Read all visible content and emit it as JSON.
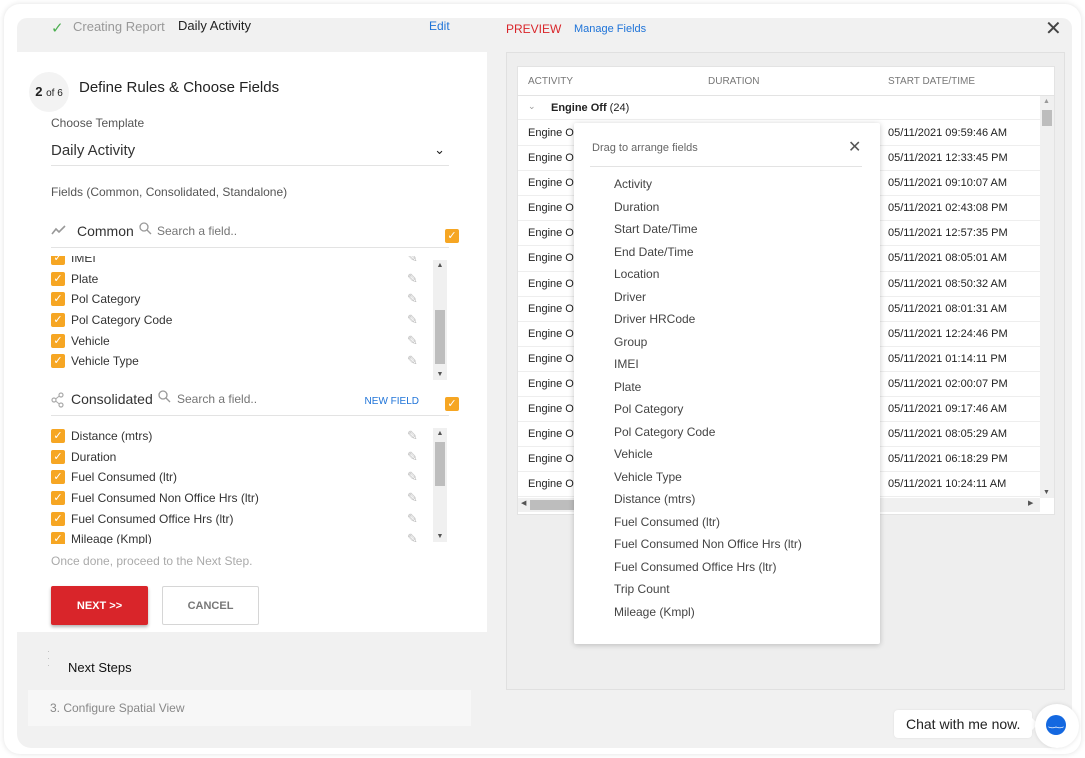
{
  "header": {
    "status_icon": "check-icon",
    "creating_label": "Creating Report",
    "report_name": "Daily Activity",
    "edit_label": "Edit"
  },
  "step": {
    "current": "2",
    "of_label": "of 6",
    "title": "Define Rules & Choose Fields"
  },
  "template": {
    "label": "Choose Template",
    "selected": "Daily Activity"
  },
  "fields_label": "Fields (Common, Consolidated, Standalone)",
  "common": {
    "title": "Common",
    "search_placeholder": "Search a field..",
    "all_checked": true,
    "items": [
      {
        "name": "IMEI",
        "checked": true
      },
      {
        "name": "Plate",
        "checked": true
      },
      {
        "name": "Pol Category",
        "checked": true
      },
      {
        "name": "Pol Category Code",
        "checked": true
      },
      {
        "name": "Vehicle",
        "checked": true
      },
      {
        "name": "Vehicle Type",
        "checked": true
      }
    ]
  },
  "consolidated": {
    "title": "Consolidated",
    "search_placeholder": "Search a field..",
    "new_field_label": "NEW FIELD",
    "all_checked": true,
    "items": [
      {
        "name": "Distance (mtrs)",
        "checked": true
      },
      {
        "name": "Duration",
        "checked": true
      },
      {
        "name": "Fuel Consumed (ltr)",
        "checked": true
      },
      {
        "name": "Fuel Consumed Non Office Hrs (ltr)",
        "checked": true
      },
      {
        "name": "Fuel Consumed Office Hrs (ltr)",
        "checked": true
      },
      {
        "name": "Mileage (Kmpl)",
        "checked": true
      }
    ]
  },
  "hint": "Once done, proceed to the Next Step.",
  "buttons": {
    "next": "NEXT >>",
    "cancel": "CANCEL"
  },
  "next_steps": {
    "title": "Next Steps",
    "items": [
      "3. Configure Spatial View"
    ]
  },
  "preview": {
    "label": "PREVIEW",
    "manage_fields": "Manage Fields",
    "columns": [
      "ACTIVITY",
      "DURATION",
      "START DATE/TIME"
    ],
    "group": {
      "title": "Engine Off",
      "count": "(24)"
    },
    "rows": [
      {
        "activity": "Engine Of",
        "start": "05/11/2021 09:59:46 AM"
      },
      {
        "activity": "Engine Of",
        "start": "05/11/2021 12:33:45 PM"
      },
      {
        "activity": "Engine Of",
        "start": "05/11/2021 09:10:07 AM"
      },
      {
        "activity": "Engine Of",
        "start": "05/11/2021 02:43:08 PM"
      },
      {
        "activity": "Engine Of",
        "start": "05/11/2021 12:57:35 PM"
      },
      {
        "activity": "Engine Of",
        "start": "05/11/2021 08:05:01 AM"
      },
      {
        "activity": "Engine Of",
        "start": "05/11/2021 08:50:32 AM"
      },
      {
        "activity": "Engine Of",
        "start": "05/11/2021 08:01:31 AM"
      },
      {
        "activity": "Engine Of",
        "start": "05/11/2021 12:24:46 PM"
      },
      {
        "activity": "Engine Of",
        "start": "05/11/2021 01:14:11 PM"
      },
      {
        "activity": "Engine Of",
        "start": "05/11/2021 02:00:07 PM"
      },
      {
        "activity": "Engine Of",
        "start": "05/11/2021 09:17:46 AM"
      },
      {
        "activity": "Engine Of",
        "start": "05/11/2021 08:05:29 AM"
      },
      {
        "activity": "Engine Of",
        "start": "05/11/2021 06:18:29 PM"
      },
      {
        "activity": "Engine Of",
        "start": "05/11/2021 10:24:11 AM"
      }
    ]
  },
  "arrange_popup": {
    "title": "Drag to arrange fields",
    "fields": [
      "Activity",
      "Duration",
      "Start Date/Time",
      "End Date/Time",
      "Location",
      "Driver",
      "Driver HRCode",
      "Group",
      "IMEI",
      "Plate",
      "Pol Category",
      "Pol Category Code",
      "Vehicle",
      "Vehicle Type",
      "Distance (mtrs)",
      "Fuel Consumed (ltr)",
      "Fuel Consumed Non Office Hrs (ltr)",
      "Fuel Consumed Office Hrs (ltr)",
      "Trip Count",
      "Mileage (Kmpl)"
    ]
  },
  "chat": {
    "label": "Chat with me now."
  },
  "colors": {
    "accent_orange": "#f6a623",
    "primary_red": "#d9252a",
    "link_blue": "#1e73d8",
    "chat_blue": "#1468e0"
  }
}
